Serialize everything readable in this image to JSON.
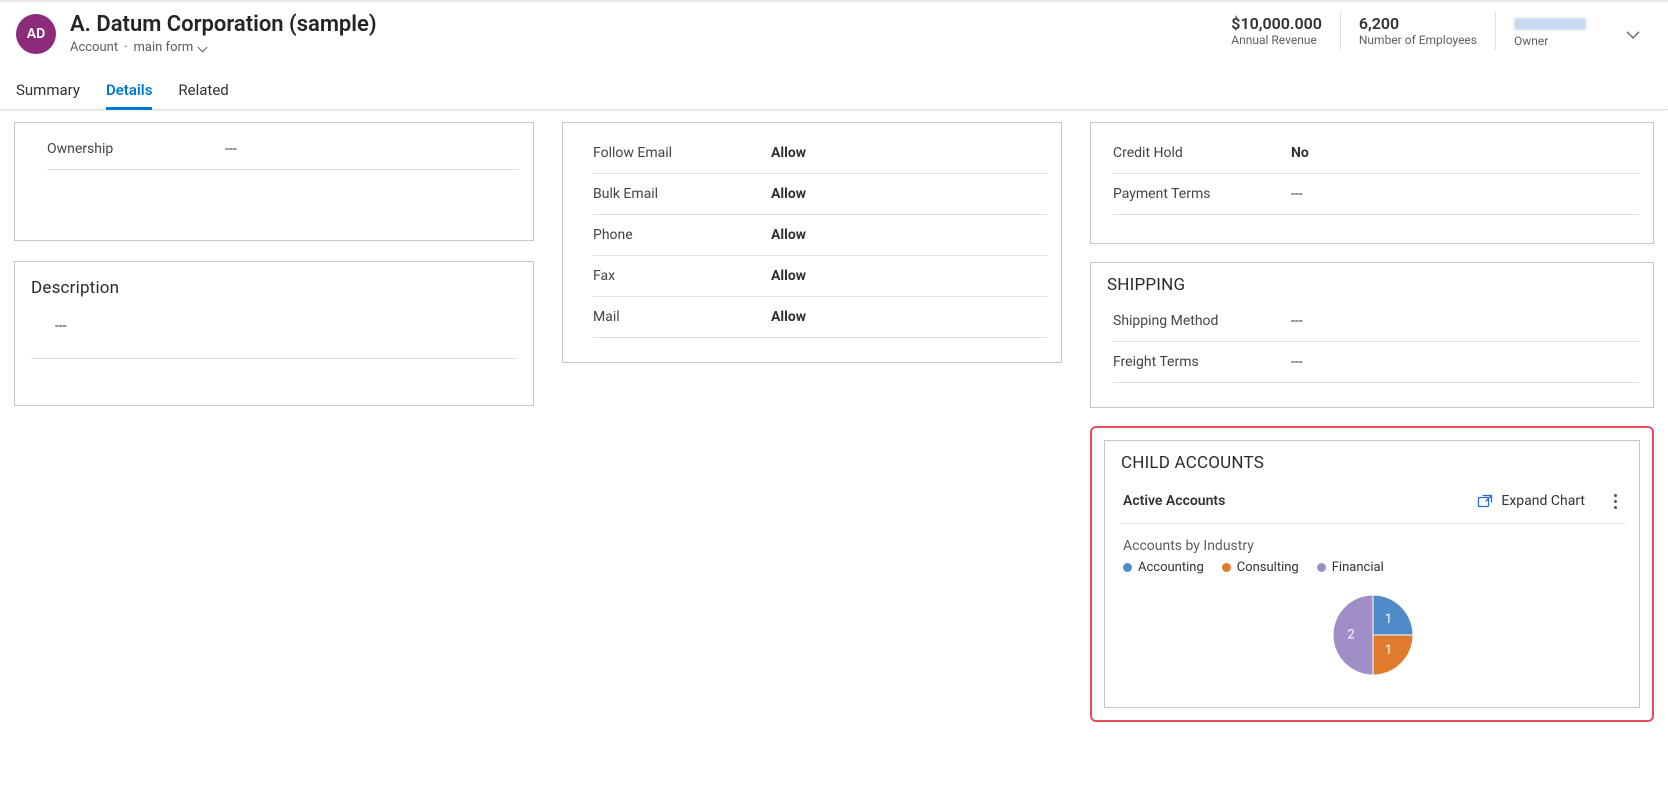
{
  "avatar_initials": "AD",
  "record_name": "A. Datum Corporation (sample)",
  "entity_label": "Account",
  "form_name": "main form",
  "metrics": {
    "revenue_value": "$10,000.000",
    "revenue_label": "Annual Revenue",
    "employees_value": "6,200",
    "employees_label": "Number of Employees",
    "owner_label": "Owner"
  },
  "tabs": {
    "summary": "Summary",
    "details": "Details",
    "related": "Related"
  },
  "ownership_card": {
    "ownership_label": "Ownership",
    "ownership_value": "---"
  },
  "description_card": {
    "title": "Description",
    "value": "---"
  },
  "contact_prefs": {
    "follow_email_label": "Follow Email",
    "follow_email_value": "Allow",
    "bulk_email_label": "Bulk Email",
    "bulk_email_value": "Allow",
    "phone_label": "Phone",
    "phone_value": "Allow",
    "fax_label": "Fax",
    "fax_value": "Allow",
    "mail_label": "Mail",
    "mail_value": "Allow"
  },
  "billing": {
    "credit_hold_label": "Credit Hold",
    "credit_hold_value": "No",
    "payment_terms_label": "Payment Terms",
    "payment_terms_value": "---"
  },
  "shipping": {
    "title": "SHIPPING",
    "method_label": "Shipping Method",
    "method_value": "---",
    "freight_label": "Freight Terms",
    "freight_value": "---"
  },
  "child_accounts": {
    "title": "CHILD ACCOUNTS",
    "view_name": "Active Accounts",
    "expand_label": "Expand Chart",
    "chart_title": "Accounts by Industry",
    "legend": {
      "accounting": "Accounting",
      "consulting": "Consulting",
      "financial": "Financial"
    }
  },
  "chart_data": {
    "type": "pie",
    "title": "Accounts by Industry",
    "series": [
      {
        "name": "Accounting",
        "value": 1,
        "color": "#4f8ac9"
      },
      {
        "name": "Consulting",
        "value": 1,
        "color": "#e07b2e"
      },
      {
        "name": "Financial",
        "value": 2,
        "color": "#9f8ec8"
      }
    ]
  }
}
